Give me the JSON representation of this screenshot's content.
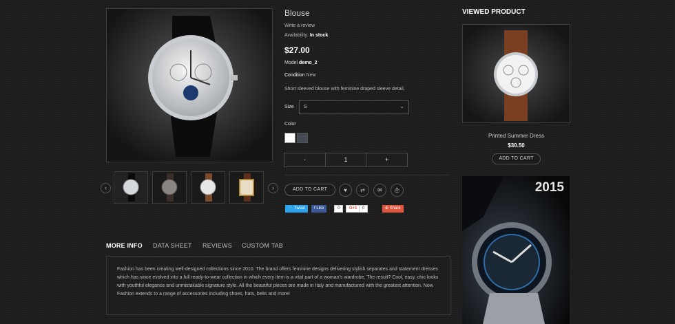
{
  "product": {
    "title": "Blouse",
    "write_review": "Write a review",
    "availability_label": "Availability:",
    "availability_value": "In stock",
    "price": "$27.00",
    "model_label": "Model",
    "model_value": "demo_2",
    "condition_label": "Condition",
    "condition_value": "New",
    "short_desc": "Short sleeved blouse with feminine draped sleeve detail.",
    "size_label": "Size",
    "size_value": "S",
    "color_label": "Color",
    "colors": [
      "#ffffff",
      "#434a54"
    ],
    "qty_minus": "-",
    "qty_value": "1",
    "qty_plus": "+",
    "add_to_cart": "ADD TO CART",
    "icons": [
      "heart-icon",
      "compare-icon",
      "mail-icon",
      "print-icon"
    ]
  },
  "social": {
    "tweet": "Tweet",
    "like": "Like",
    "like_count": "0",
    "gplus": "G+1",
    "gplus_count": "0",
    "share": "Share"
  },
  "thumbnails": {
    "prev": "‹",
    "next": "›"
  },
  "tabs": {
    "items": [
      "MORE INFO",
      "DATA SHEET",
      "REVIEWS",
      "CUSTOM TAB"
    ],
    "content": "Fashion has been creating well-designed collections since 2010. The brand offers feminine designs delivering stylish separates and statement dresses which has since evolved into a full ready-to-wear collection in which every item is a vital part of a woman's wardrobe. The result? Cool, easy, chic looks with youthful elegance and unmistakable signature style. All the beautiful pieces are made in Italy and manufactured with the greatest attention. Now Fashion extends to a range of accessories including shoes, hats, belts and more!"
  },
  "viewed": {
    "title": "VIEWED PRODUCT",
    "name": "Printed Summer Dress",
    "price": "$30.50",
    "add_to_cart": "ADD TO CART"
  },
  "banner": {
    "year": "2015"
  }
}
